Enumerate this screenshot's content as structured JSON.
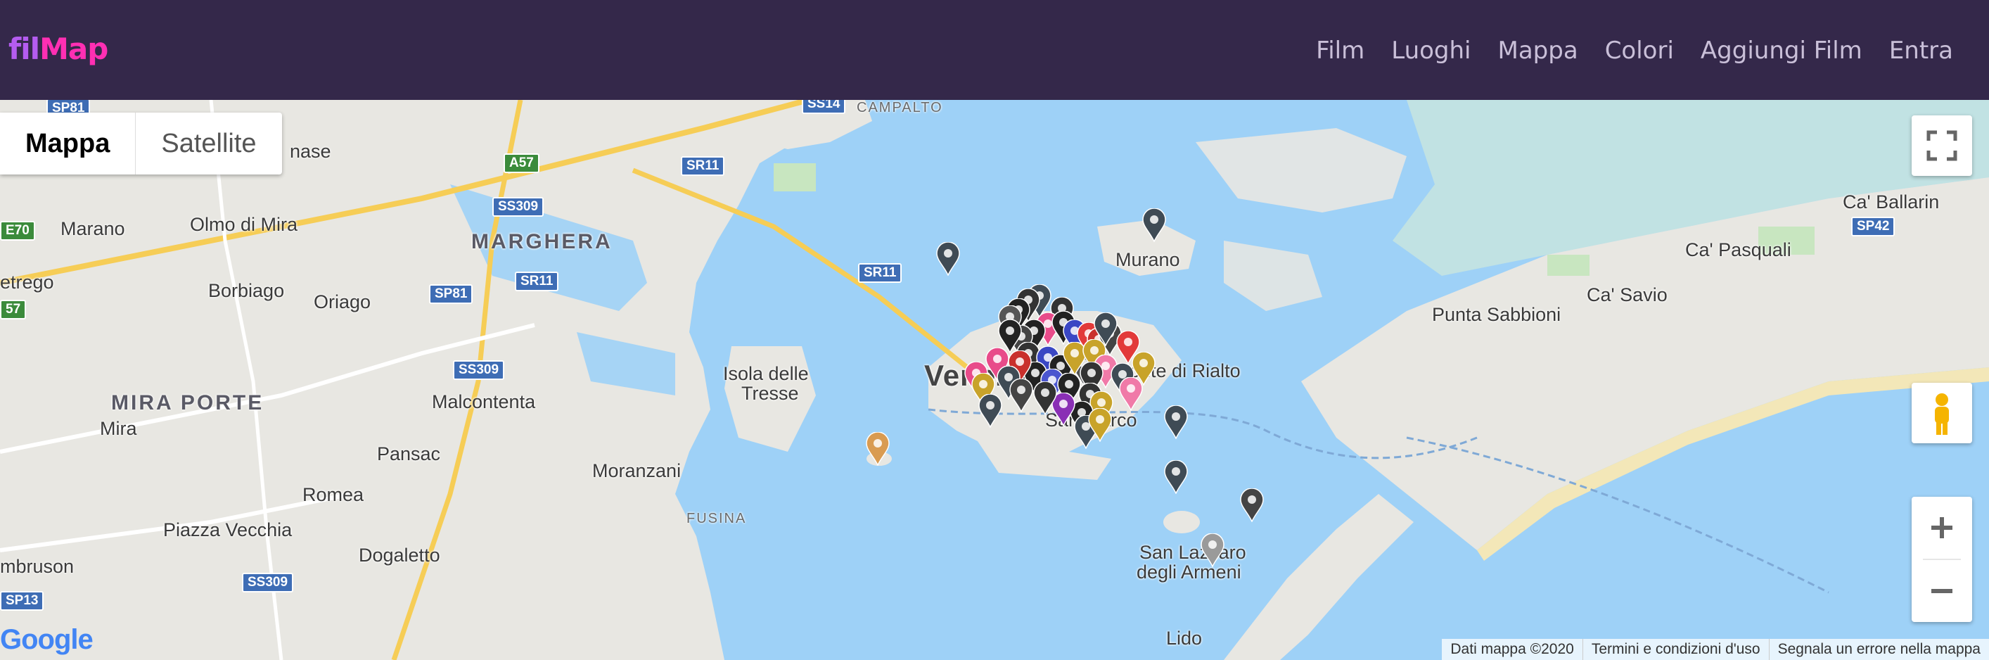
{
  "brand": {
    "part1": "fil",
    "part2": "Map"
  },
  "nav": {
    "items": [
      "Film",
      "Luoghi",
      "Mappa",
      "Colori",
      "Aggiungi Film",
      "Entra"
    ]
  },
  "map": {
    "type_control": {
      "map": "Mappa",
      "satellite": "Satellite"
    },
    "labels": {
      "marghera": "MARGHERA",
      "mira_porte": "MIRA PORTE",
      "venezia": "Venezia",
      "murano": "Murano",
      "rialto": "Ponte di Rialto",
      "san_marco": "San Marco",
      "isola_tresse_1": "Isola delle",
      "isola_tresse_2": "Tresse",
      "campalto": "CAMPALTO",
      "fusina": "FUSINA",
      "punta_sabbioni": "Punta Sabbioni",
      "ca_savio": "Ca' Savio",
      "ca_ballarin": "Ca' Ballarin",
      "ca_pasquali": "Ca' Pasquali",
      "san_lazzaro_1": "San Lazzaro",
      "san_lazzaro_2": "degli Armeni",
      "lido": "Lido",
      "marano": "Marano",
      "olmo": "Olmo di Mira",
      "borbiago": "Borbiago",
      "oriago": "Oriago",
      "mira": "Mira",
      "malcontenta": "Malcontenta",
      "pansac": "Pansac",
      "moranzani": "Moranzani",
      "romea": "Romea",
      "piazza_vecchia": "Piazza Vecchia",
      "dogaletto": "Dogaletto",
      "ambruson": "mbruson",
      "etrego": "etrego",
      "nase": "nase"
    },
    "roads": [
      "SP81",
      "SS14",
      "A57",
      "SR11",
      "SS309",
      "SR11",
      "SP81",
      "SR11",
      "SS309",
      "SS309",
      "SP13",
      "SP42",
      "E70",
      "57"
    ],
    "attribution": [
      "Dati mappa ©2020",
      "Termini e condizioni d'uso",
      "Segnala un errore nella mappa"
    ],
    "google": "Google",
    "colors": {
      "water": "#9ed1f7",
      "land": "#e9e8e3",
      "nav_bg": "#34284a",
      "accent1": "#b45cf0",
      "accent2": "#ff2fb3"
    }
  }
}
